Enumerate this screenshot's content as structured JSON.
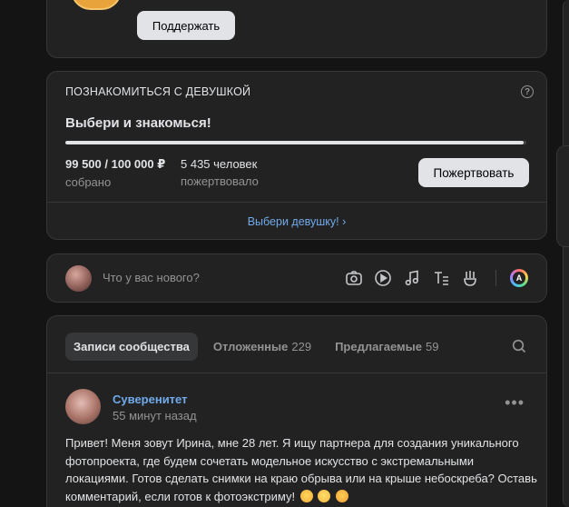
{
  "support": {
    "button_label": "Поддержать"
  },
  "fundraiser": {
    "header": "ПОЗНАКОМИТЬСЯ С ДЕВУШКОЙ",
    "help_glyph": "?",
    "title": "Выбери и знакомься!",
    "progress_fraction": 0.995,
    "collected_value": "99 500",
    "goal_value": "/ 100 000 ₽",
    "collected_label": "собрано",
    "donors_value": "5 435 человек",
    "donors_label": "пожертвовало",
    "donate_label": "Пожертвовать",
    "link_label": "Выбери девушку! ›"
  },
  "composer": {
    "placeholder": "Что у вас нового?",
    "tools": [
      "camera-icon",
      "video-play-icon",
      "music-icon",
      "text-format-icon",
      "clip-icon"
    ],
    "ai_label": "A"
  },
  "wall": {
    "tabs": [
      {
        "label": "Записи сообщества",
        "count": ""
      },
      {
        "label": "Отложенные",
        "count": "229"
      },
      {
        "label": "Предлагаемые",
        "count": "59"
      }
    ],
    "post": {
      "author": "Суверенитет",
      "time": "55 минут назад",
      "menu": "•••",
      "text": "Привет! Меня зовут Ирина, мне 28 лет. Я ищу партнера для создания уникального фотопроекта, где будем сочетать модельное искусство с экстремальными локациями. Готов сделать снимки на краю обрыва или на крыше небоскреба? Оставь комментарий, если готов к фотоэкстриму!",
      "emojis": [
        "kiss-emoji",
        "rolling-eyes-emoji",
        "hearts-emoji"
      ]
    }
  },
  "colors": {
    "background": "#141414",
    "card": "#222222",
    "link": "#71aaeb",
    "text": "#e1e3e6",
    "secondary": "#939393"
  }
}
